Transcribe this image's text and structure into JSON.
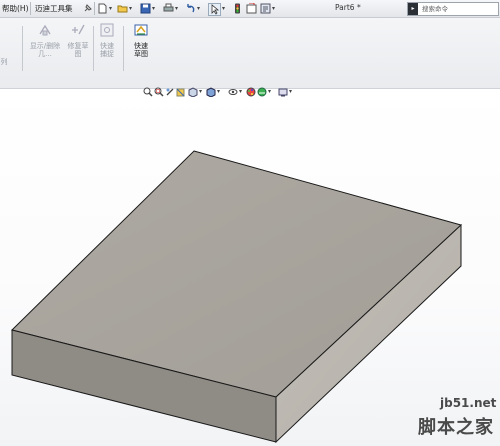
{
  "menu": {
    "help": "帮助(H)",
    "tools_set": "迈迪工具集"
  },
  "document": {
    "title": "Part6 *"
  },
  "search": {
    "placeholder": "搜索命令"
  },
  "ribbon": {
    "partial_left": "列",
    "show_relations": "显示/删除几...",
    "repair_sketch": "修复草图",
    "quick_snap": "快速捕捉",
    "rapid_sketch": "快速草图"
  },
  "watermark": {
    "site": "jb51.net",
    "name": "脚本之家"
  },
  "colors": {
    "top_face": "#a8a49d",
    "front_face": "#8f8b85",
    "right_face": "#bcb8b1",
    "edge": "#1a1a1a"
  }
}
